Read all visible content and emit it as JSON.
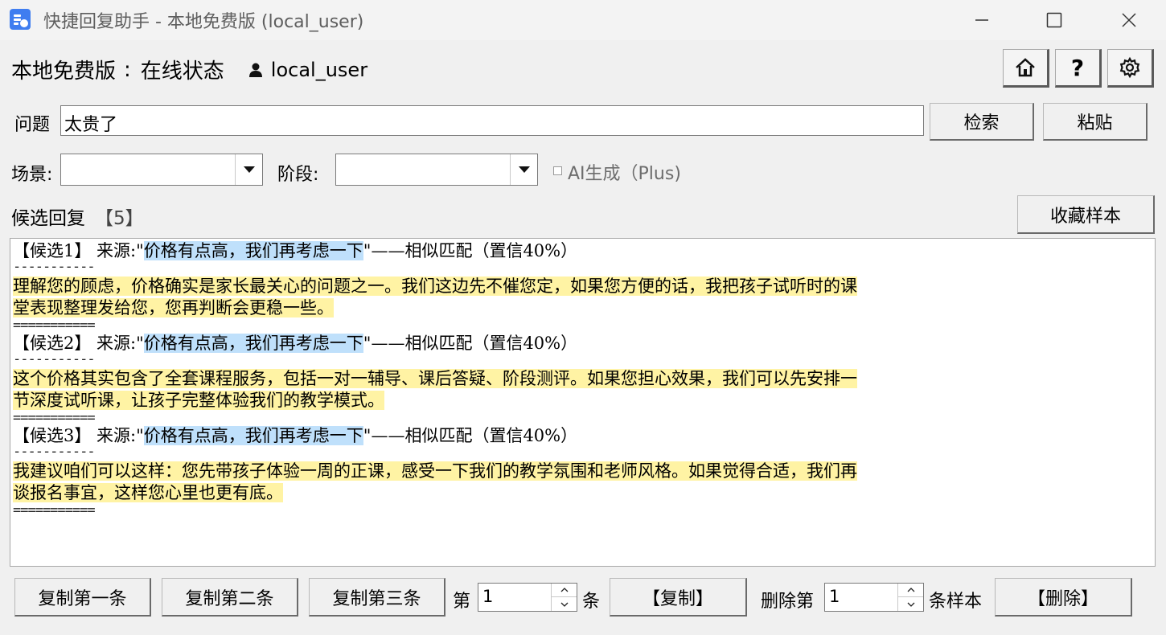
{
  "window": {
    "title": "快捷回复助手 - 本地免费版 (local_user)",
    "accent": "#3f7df0"
  },
  "header": {
    "edition": "本地免费版",
    "separator": ":",
    "status": "在线状态",
    "username": "local_user",
    "icons": [
      "home-icon",
      "help-icon",
      "gear-icon"
    ],
    "help_label": "?"
  },
  "question": {
    "label": "问题",
    "value": "太贵了",
    "search_button": "检索",
    "paste_button": "粘贴"
  },
  "filters": {
    "scene_label": "场景:",
    "scene_value": "",
    "stage_label": "阶段:",
    "stage_value": "",
    "ai_label": "AI生成（Plus)",
    "ai_checked": false
  },
  "candidates": {
    "title": "候选回复",
    "count": "【5】",
    "favorite_button": "收藏样本",
    "separator_short": "-----------",
    "separator_long": "===========",
    "items": [
      {
        "header_prefix": "【候选1】 来源:\"",
        "source": "价格有点高，我们再考虑一下",
        "header_suffix": "\"——相似匹配（置信40%）",
        "body_line1": "理解您的顾虑，价格确实是家长最关心的问题之一。我们这边先不催您定，如果您方便的话，我把孩子试听时的课",
        "body_line2": "堂表现整理发给您，您再判断会更稳一些。"
      },
      {
        "header_prefix": "【候选2】 来源:\"",
        "source": "价格有点高，我们再考虑一下",
        "header_suffix": "\"——相似匹配（置信40%）",
        "body_line1": "这个价格其实包含了全套课程服务，包括一对一辅导、课后答疑、阶段测评。如果您担心效果，我们可以先安排一",
        "body_line2": "节深度试听课，让孩子完整体验我们的教学模式。"
      },
      {
        "header_prefix": "【候选3】 来源:\"",
        "source": "价格有点高，我们再考虑一下",
        "header_suffix": "\"——相似匹配（置信40%）",
        "body_line1": "我建议咱们可以这样：您先带孩子体验一周的正课，感受一下我们的教学氛围和老师风格。如果觉得合适，我们再",
        "body_line2": "谈报名事宜，这样您心里也更有底。"
      }
    ],
    "highlight_source": "#bfe0fb",
    "highlight_body": "#fff3a4"
  },
  "bottom": {
    "copy_first": "复制第一条",
    "copy_second": "复制第二条",
    "copy_third": "复制第三条",
    "nth_prefix": "第",
    "nth_value": "1",
    "nth_suffix": "条",
    "copy_button": "【复制】",
    "delete_prefix": "删除第",
    "delete_value": "1",
    "delete_suffix": "条样本",
    "delete_button": "【删除】"
  }
}
